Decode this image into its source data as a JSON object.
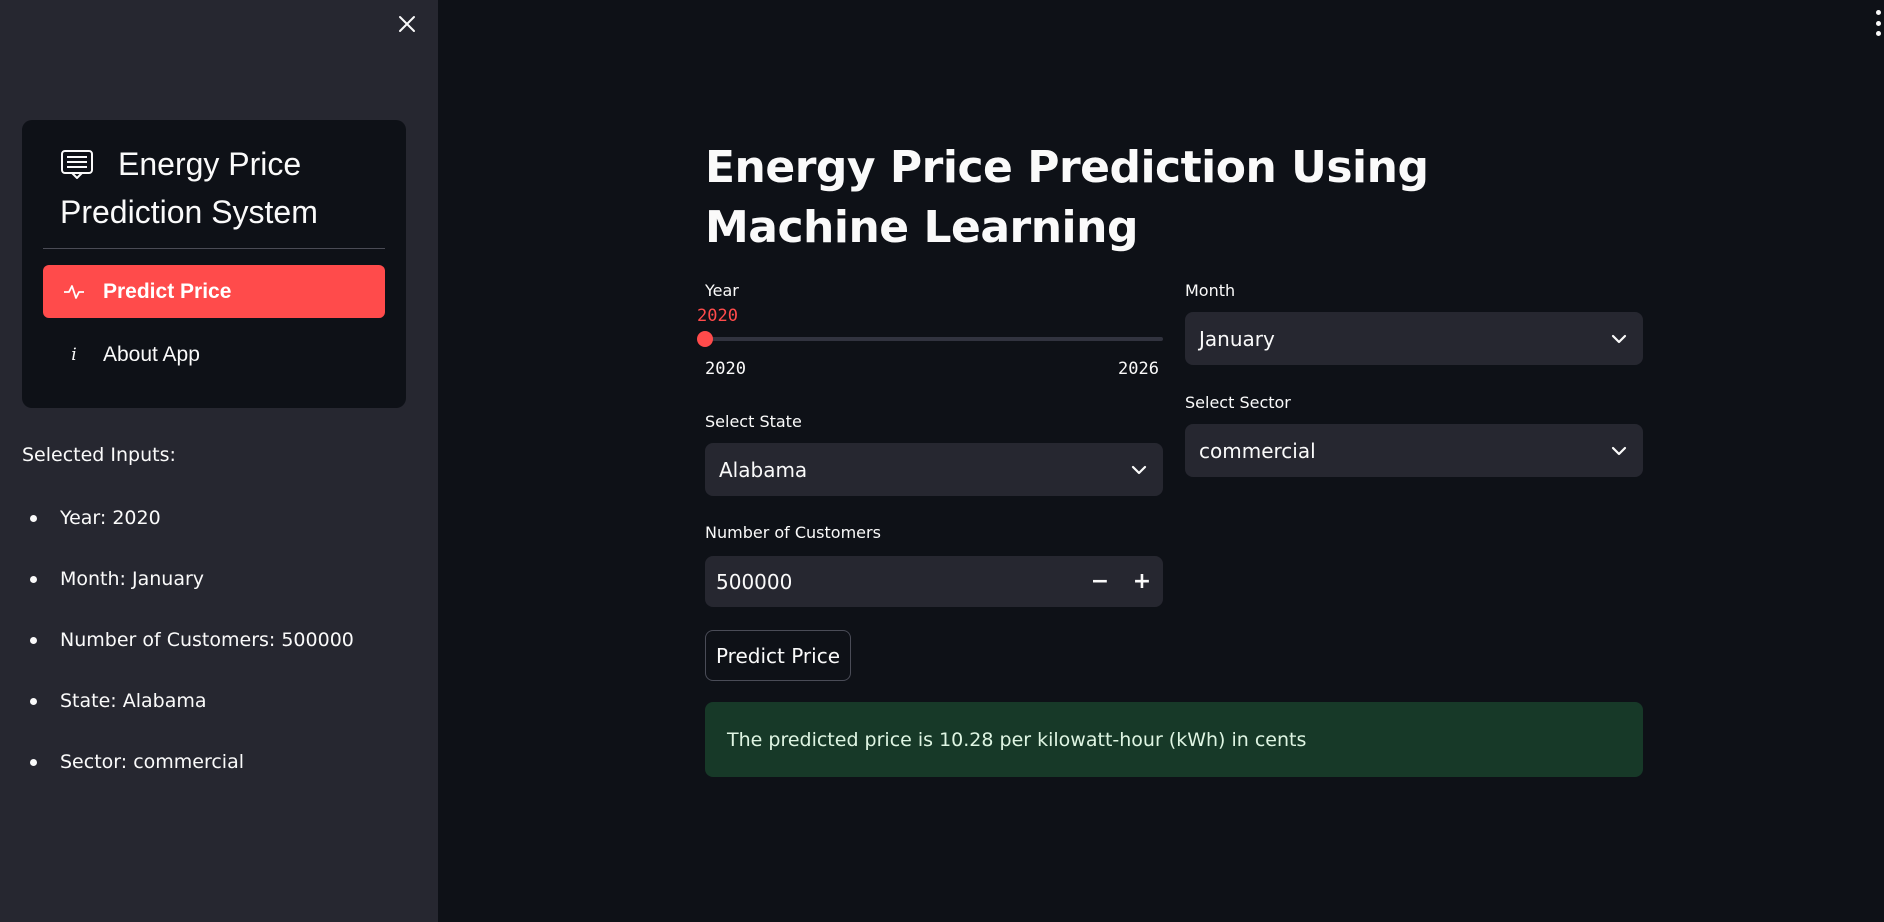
{
  "sidebar": {
    "menu_title": "Energy Price Prediction System",
    "menu_title_icon": "newspaper-icon",
    "menu_items": [
      {
        "label": "Predict Price",
        "icon": "activity-icon",
        "active": true
      },
      {
        "label": "About App",
        "icon": "info-icon",
        "active": false
      }
    ],
    "about_icon_glyph": "i",
    "selected_heading": "Selected Inputs:",
    "selected_items": [
      "Year: 2020",
      "Month: January",
      "Number of Customers: 500000",
      "State: Alabama",
      "Sector: commercial"
    ]
  },
  "main": {
    "title": "Energy Price Prediction Using Machine Learning",
    "year": {
      "label": "Year",
      "value": "2020",
      "min": "2020",
      "max": "2026",
      "fraction": 0
    },
    "month": {
      "label": "Month",
      "value": "January"
    },
    "state": {
      "label": "Select State",
      "value": "Alabama"
    },
    "sector": {
      "label": "Select Sector",
      "value": "commercial"
    },
    "customers": {
      "label": "Number of Customers",
      "value": "500000",
      "minus": "−",
      "plus": "+"
    },
    "predict_button": "Predict Price",
    "result_text": "The predicted price is 10.28 per kilowatt-hour (kWh) in cents"
  },
  "colors": {
    "accent": "#ff4b4b",
    "background": "#0e1117",
    "sidebar": "#262730",
    "success_bg": "#173928"
  }
}
